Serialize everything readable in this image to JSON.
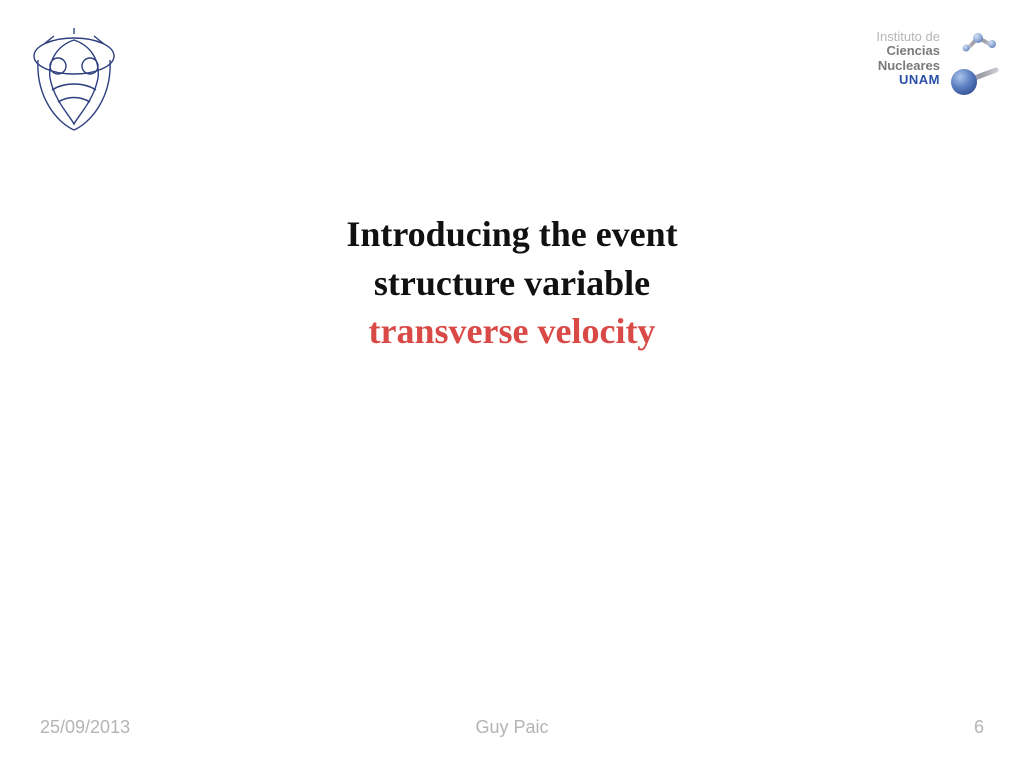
{
  "logos": {
    "right": {
      "line1": "Instituto de",
      "line2": "Ciencias",
      "line3": "Nucleares",
      "line4": "UNAM"
    }
  },
  "title": {
    "line1": "Introducing the event",
    "line2": "structure variable",
    "line3": "transverse velocity"
  },
  "footer": {
    "date": "25/09/2013",
    "author": "Guy Paic",
    "page": "6"
  }
}
